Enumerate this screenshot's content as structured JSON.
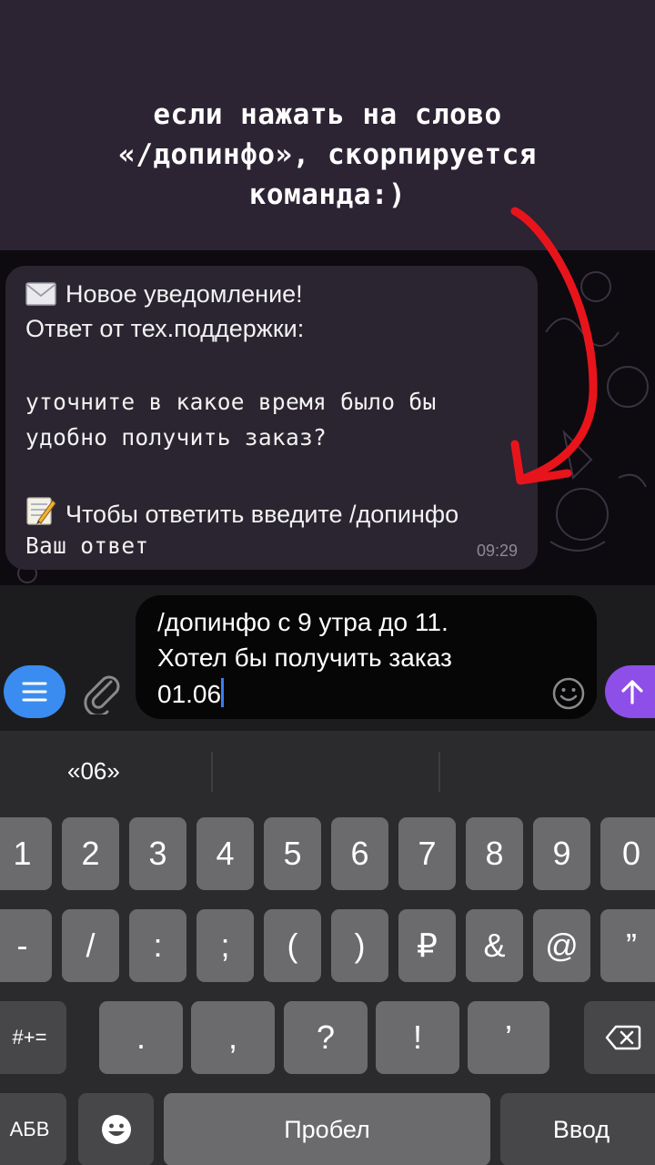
{
  "caption": "если нажать на слово\n«/допинфо», скорпируется\nкоманда:)",
  "message": {
    "line1": "Новое уведомление!",
    "line2": "Ответ от тех.поддержки:",
    "line3": "уточните в какое время было бы",
    "line4": "удобно получить заказ?",
    "line5": "Чтобы ответить введите /допинфо",
    "line6": "Ваш ответ",
    "time": "09:29",
    "icon1": "envelope-emoji",
    "icon2": "memo-emoji"
  },
  "composer": {
    "line1": "/допинфо с 9 утра до 11.",
    "line2": "Хотел бы получить заказ",
    "line3": "01.06"
  },
  "keyboard": {
    "suggestion": "«06»",
    "row1": [
      "1",
      "2",
      "3",
      "4",
      "5",
      "6",
      "7",
      "8",
      "9",
      "0"
    ],
    "row2": [
      "-",
      "/",
      ":",
      ";",
      "(",
      ")",
      "₽",
      "&",
      "@",
      "”"
    ],
    "row3": [
      "#+=",
      ".",
      ",",
      "?",
      "!",
      "’"
    ],
    "switch": "АБВ",
    "space": "Пробел",
    "enter": "Ввод"
  },
  "colors": {
    "accent_blue": "#3a8cf0",
    "send_purple": "#8e4fe8",
    "arrow_red": "#e8141c"
  }
}
